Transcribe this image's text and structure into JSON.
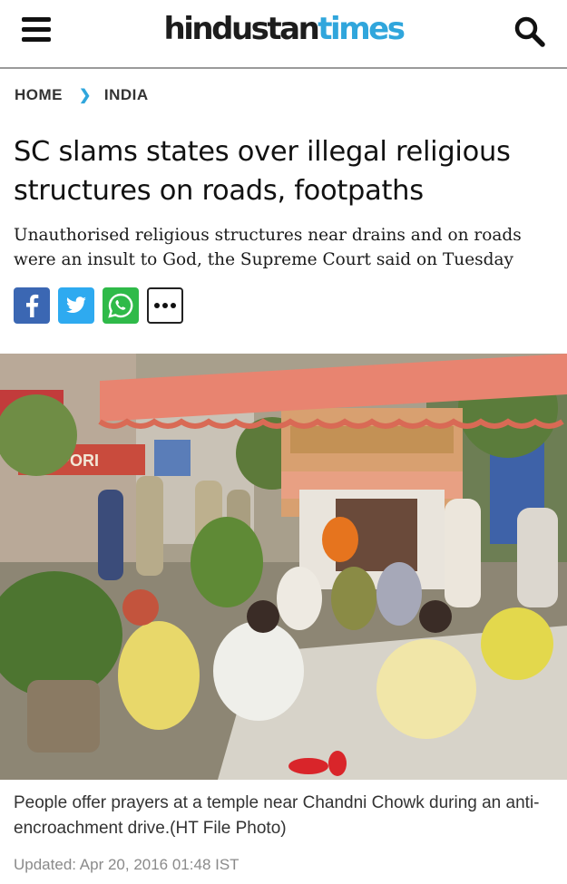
{
  "header": {
    "logo_part1": "hindustan",
    "logo_part2": "times",
    "menu_icon": "hamburger-menu-icon",
    "search_icon": "search-icon"
  },
  "breadcrumb": {
    "home": "HOME",
    "separator_icon": "chevron-right-icon",
    "section": "INDIA"
  },
  "article": {
    "headline": "SC slams states over illegal religious structures on roads, footpaths",
    "summary": "Unauthorised religious structures near drains and on roads were an insult to God, the Supreme Court said on Tuesday",
    "caption": "People offer prayers at a temple near Chandni Chowk during an anti-encroachment drive.(HT File Photo)",
    "updated": "Updated: Apr 20, 2016 01:48 IST"
  },
  "share": [
    {
      "network": "facebook",
      "icon": "facebook-icon",
      "color": "#3b67b3"
    },
    {
      "network": "twitter",
      "icon": "twitter-icon",
      "color": "#2eaaf0"
    },
    {
      "network": "whatsapp",
      "icon": "whatsapp-icon",
      "color": "#2fba49"
    },
    {
      "network": "more",
      "icon": "more-dots-icon",
      "color": "#ffffff"
    }
  ],
  "photo": {
    "awning_color": "#e88470",
    "signs": [
      "EMPORI"
    ]
  },
  "colors": {
    "brand_blue": "#30a6dc",
    "text_dark": "#111111",
    "meta_grey": "#8a8a8a"
  }
}
